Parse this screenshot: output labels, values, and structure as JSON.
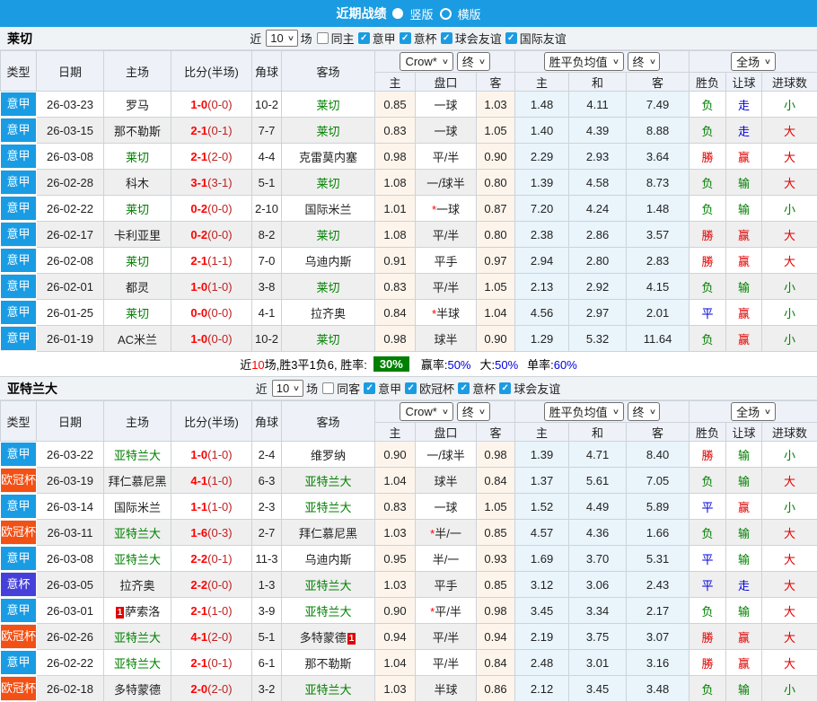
{
  "title_bar": {
    "title": "近期战绩",
    "radio_vertical": "竖版",
    "radio_horizontal": "横版"
  },
  "colors": {
    "topbar": "#1b9ce2",
    "league_serie_a": "#199ce3",
    "league_ucl": "#f25014",
    "league_coppa": "#4540da",
    "focus_team": "#008000",
    "score": "#ff0000",
    "win_red": "#e10000",
    "draw_blue": "#0000dd",
    "lose_green": "#008000"
  },
  "table_header": {
    "type": "类型",
    "date": "日期",
    "home": "主场",
    "score": "比分(半场)",
    "corner": "角球",
    "away": "客场",
    "asian_source": "Crow*",
    "asian_state": "终",
    "asian_home": "主",
    "asian_line": "盘口",
    "asian_away": "客",
    "euro_source": "胜平负均值",
    "euro_state": "终",
    "euro_home": "主",
    "euro_draw": "和",
    "euro_away": "客",
    "scope": "全场",
    "res_wl": "胜负",
    "res_handicap": "让球",
    "res_goals": "进球数"
  },
  "sections": [
    {
      "team": "莱切",
      "filter": {
        "near": "近",
        "count": "10",
        "games": "场",
        "same_label": "同主",
        "leagues": [
          "意甲",
          "意杯",
          "球会友谊",
          "国际友谊"
        ]
      },
      "rows": [
        {
          "league": "意甲",
          "date": "26-03-23",
          "home": "罗马",
          "home_focus": false,
          "home_card": "",
          "score_ft": "1-0",
          "score_ht": "(0-0)",
          "corner": "10-2",
          "away": "莱切",
          "away_focus": true,
          "away_card": "",
          "ah_home": "0.85",
          "ah_star": false,
          "ah_line": "一球",
          "ah_away": "1.03",
          "eu_home": "1.48",
          "eu_draw": "4.11",
          "eu_away": "7.49",
          "res_wl": "负",
          "res_ah": "走",
          "res_goal": "小"
        },
        {
          "league": "意甲",
          "date": "26-03-15",
          "home": "那不勒斯",
          "home_focus": false,
          "home_card": "",
          "score_ft": "2-1",
          "score_ht": "(0-1)",
          "corner": "7-7",
          "away": "莱切",
          "away_focus": true,
          "away_card": "",
          "ah_home": "0.83",
          "ah_star": false,
          "ah_line": "一球",
          "ah_away": "1.05",
          "eu_home": "1.40",
          "eu_draw": "4.39",
          "eu_away": "8.88",
          "res_wl": "负",
          "res_ah": "走",
          "res_goal": "大"
        },
        {
          "league": "意甲",
          "date": "26-03-08",
          "home": "莱切",
          "home_focus": true,
          "home_card": "",
          "score_ft": "2-1",
          "score_ht": "(2-0)",
          "corner": "4-4",
          "away": "克雷莫内塞",
          "away_focus": false,
          "away_card": "",
          "ah_home": "0.98",
          "ah_star": false,
          "ah_line": "平/半",
          "ah_away": "0.90",
          "eu_home": "2.29",
          "eu_draw": "2.93",
          "eu_away": "3.64",
          "res_wl": "勝",
          "res_ah": "赢",
          "res_goal": "大"
        },
        {
          "league": "意甲",
          "date": "26-02-28",
          "home": "科木",
          "home_focus": false,
          "home_card": "",
          "score_ft": "3-1",
          "score_ht": "(3-1)",
          "corner": "5-1",
          "away": "莱切",
          "away_focus": true,
          "away_card": "",
          "ah_home": "1.08",
          "ah_star": false,
          "ah_line": "一/球半",
          "ah_away": "0.80",
          "eu_home": "1.39",
          "eu_draw": "4.58",
          "eu_away": "8.73",
          "res_wl": "负",
          "res_ah": "输",
          "res_goal": "大"
        },
        {
          "league": "意甲",
          "date": "26-02-22",
          "home": "莱切",
          "home_focus": true,
          "home_card": "",
          "score_ft": "0-2",
          "score_ht": "(0-0)",
          "corner": "2-10",
          "away": "国际米兰",
          "away_focus": false,
          "away_card": "",
          "ah_home": "1.01",
          "ah_star": true,
          "ah_line": "一球",
          "ah_away": "0.87",
          "eu_home": "7.20",
          "eu_draw": "4.24",
          "eu_away": "1.48",
          "res_wl": "负",
          "res_ah": "输",
          "res_goal": "小"
        },
        {
          "league": "意甲",
          "date": "26-02-17",
          "home": "卡利亚里",
          "home_focus": false,
          "home_card": "",
          "score_ft": "0-2",
          "score_ht": "(0-0)",
          "corner": "8-2",
          "away": "莱切",
          "away_focus": true,
          "away_card": "",
          "ah_home": "1.08",
          "ah_star": false,
          "ah_line": "平/半",
          "ah_away": "0.80",
          "eu_home": "2.38",
          "eu_draw": "2.86",
          "eu_away": "3.57",
          "res_wl": "勝",
          "res_ah": "赢",
          "res_goal": "大"
        },
        {
          "league": "意甲",
          "date": "26-02-08",
          "home": "莱切",
          "home_focus": true,
          "home_card": "",
          "score_ft": "2-1",
          "score_ht": "(1-1)",
          "corner": "7-0",
          "away": "乌迪内斯",
          "away_focus": false,
          "away_card": "",
          "ah_home": "0.91",
          "ah_star": false,
          "ah_line": "平手",
          "ah_away": "0.97",
          "eu_home": "2.94",
          "eu_draw": "2.80",
          "eu_away": "2.83",
          "res_wl": "勝",
          "res_ah": "赢",
          "res_goal": "大"
        },
        {
          "league": "意甲",
          "date": "26-02-01",
          "home": "都灵",
          "home_focus": false,
          "home_card": "",
          "score_ft": "1-0",
          "score_ht": "(1-0)",
          "corner": "3-8",
          "away": "莱切",
          "away_focus": true,
          "away_card": "",
          "ah_home": "0.83",
          "ah_star": false,
          "ah_line": "平/半",
          "ah_away": "1.05",
          "eu_home": "2.13",
          "eu_draw": "2.92",
          "eu_away": "4.15",
          "res_wl": "负",
          "res_ah": "输",
          "res_goal": "小"
        },
        {
          "league": "意甲",
          "date": "26-01-25",
          "home": "莱切",
          "home_focus": true,
          "home_card": "",
          "score_ft": "0-0",
          "score_ht": "(0-0)",
          "corner": "4-1",
          "away": "拉齐奥",
          "away_focus": false,
          "away_card": "",
          "ah_home": "0.84",
          "ah_star": true,
          "ah_line": "半球",
          "ah_away": "1.04",
          "eu_home": "4.56",
          "eu_draw": "2.97",
          "eu_away": "2.01",
          "res_wl": "平",
          "res_ah": "赢",
          "res_goal": "小"
        },
        {
          "league": "意甲",
          "date": "26-01-19",
          "home": "AC米兰",
          "home_focus": false,
          "home_card": "",
          "score_ft": "1-0",
          "score_ht": "(0-0)",
          "corner": "10-2",
          "away": "莱切",
          "away_focus": true,
          "away_card": "",
          "ah_home": "0.98",
          "ah_star": false,
          "ah_line": "球半",
          "ah_away": "0.90",
          "eu_home": "1.29",
          "eu_draw": "5.32",
          "eu_away": "11.64",
          "res_wl": "负",
          "res_ah": "赢",
          "res_goal": "小"
        }
      ],
      "summary": {
        "prefix": "近",
        "count": "10",
        "mid": "场,胜3平1负6, 胜率:",
        "win_rate": "30%",
        "stats": [
          {
            "label": "赢率:",
            "value": "50%"
          },
          {
            "label": "大:",
            "value": "50%"
          },
          {
            "label": "单率:",
            "value": "60%"
          }
        ]
      }
    },
    {
      "team": "亚特兰大",
      "filter": {
        "near": "近",
        "count": "10",
        "games": "场",
        "same_label": "同客",
        "leagues": [
          "意甲",
          "欧冠杯",
          "意杯",
          "球会友谊"
        ]
      },
      "rows": [
        {
          "league": "意甲",
          "date": "26-03-22",
          "home": "亚特兰大",
          "home_focus": true,
          "home_card": "",
          "score_ft": "1-0",
          "score_ht": "(1-0)",
          "corner": "2-4",
          "away": "维罗纳",
          "away_focus": false,
          "away_card": "",
          "ah_home": "0.90",
          "ah_star": false,
          "ah_line": "一/球半",
          "ah_away": "0.98",
          "eu_home": "1.39",
          "eu_draw": "4.71",
          "eu_away": "8.40",
          "res_wl": "勝",
          "res_ah": "输",
          "res_goal": "小"
        },
        {
          "league": "欧冠杯",
          "date": "26-03-19",
          "home": "拜仁慕尼黑",
          "home_focus": false,
          "home_card": "",
          "score_ft": "4-1",
          "score_ht": "(1-0)",
          "corner": "6-3",
          "away": "亚特兰大",
          "away_focus": true,
          "away_card": "",
          "ah_home": "1.04",
          "ah_star": false,
          "ah_line": "球半",
          "ah_away": "0.84",
          "eu_home": "1.37",
          "eu_draw": "5.61",
          "eu_away": "7.05",
          "res_wl": "负",
          "res_ah": "输",
          "res_goal": "大"
        },
        {
          "league": "意甲",
          "date": "26-03-14",
          "home": "国际米兰",
          "home_focus": false,
          "home_card": "",
          "score_ft": "1-1",
          "score_ht": "(1-0)",
          "corner": "2-3",
          "away": "亚特兰大",
          "away_focus": true,
          "away_card": "",
          "ah_home": "0.83",
          "ah_star": false,
          "ah_line": "一球",
          "ah_away": "1.05",
          "eu_home": "1.52",
          "eu_draw": "4.49",
          "eu_away": "5.89",
          "res_wl": "平",
          "res_ah": "赢",
          "res_goal": "小"
        },
        {
          "league": "欧冠杯",
          "date": "26-03-11",
          "home": "亚特兰大",
          "home_focus": true,
          "home_card": "",
          "score_ft": "1-6",
          "score_ht": "(0-3)",
          "corner": "2-7",
          "away": "拜仁慕尼黑",
          "away_focus": false,
          "away_card": "",
          "ah_home": "1.03",
          "ah_star": true,
          "ah_line": "半/一",
          "ah_away": "0.85",
          "eu_home": "4.57",
          "eu_draw": "4.36",
          "eu_away": "1.66",
          "res_wl": "负",
          "res_ah": "输",
          "res_goal": "大"
        },
        {
          "league": "意甲",
          "date": "26-03-08",
          "home": "亚特兰大",
          "home_focus": true,
          "home_card": "",
          "score_ft": "2-2",
          "score_ht": "(0-1)",
          "corner": "11-3",
          "away": "乌迪内斯",
          "away_focus": false,
          "away_card": "",
          "ah_home": "0.95",
          "ah_star": false,
          "ah_line": "半/一",
          "ah_away": "0.93",
          "eu_home": "1.69",
          "eu_draw": "3.70",
          "eu_away": "5.31",
          "res_wl": "平",
          "res_ah": "输",
          "res_goal": "大"
        },
        {
          "league": "意杯",
          "date": "26-03-05",
          "home": "拉齐奥",
          "home_focus": false,
          "home_card": "",
          "score_ft": "2-2",
          "score_ht": "(0-0)",
          "corner": "1-3",
          "away": "亚特兰大",
          "away_focus": true,
          "away_card": "",
          "ah_home": "1.03",
          "ah_star": false,
          "ah_line": "平手",
          "ah_away": "0.85",
          "eu_home": "3.12",
          "eu_draw": "3.06",
          "eu_away": "2.43",
          "res_wl": "平",
          "res_ah": "走",
          "res_goal": "大"
        },
        {
          "league": "意甲",
          "date": "26-03-01",
          "home": "萨索洛",
          "home_focus": false,
          "home_card": "1",
          "score_ft": "2-1",
          "score_ht": "(1-0)",
          "corner": "3-9",
          "away": "亚特兰大",
          "away_focus": true,
          "away_card": "",
          "ah_home": "0.90",
          "ah_star": true,
          "ah_line": "平/半",
          "ah_away": "0.98",
          "eu_home": "3.45",
          "eu_draw": "3.34",
          "eu_away": "2.17",
          "res_wl": "负",
          "res_ah": "输",
          "res_goal": "大"
        },
        {
          "league": "欧冠杯",
          "date": "26-02-26",
          "home": "亚特兰大",
          "home_focus": true,
          "home_card": "",
          "score_ft": "4-1",
          "score_ht": "(2-0)",
          "corner": "5-1",
          "away": "多特蒙德",
          "away_focus": false,
          "away_card": "1",
          "ah_home": "0.94",
          "ah_star": false,
          "ah_line": "平/半",
          "ah_away": "0.94",
          "eu_home": "2.19",
          "eu_draw": "3.75",
          "eu_away": "3.07",
          "res_wl": "勝",
          "res_ah": "赢",
          "res_goal": "大"
        },
        {
          "league": "意甲",
          "date": "26-02-22",
          "home": "亚特兰大",
          "home_focus": true,
          "home_card": "",
          "score_ft": "2-1",
          "score_ht": "(0-1)",
          "corner": "6-1",
          "away": "那不勒斯",
          "away_focus": false,
          "away_card": "",
          "ah_home": "1.04",
          "ah_star": false,
          "ah_line": "平/半",
          "ah_away": "0.84",
          "eu_home": "2.48",
          "eu_draw": "3.01",
          "eu_away": "3.16",
          "res_wl": "勝",
          "res_ah": "赢",
          "res_goal": "大"
        },
        {
          "league": "欧冠杯",
          "date": "26-02-18",
          "home": "多特蒙德",
          "home_focus": false,
          "home_card": "",
          "score_ft": "2-0",
          "score_ht": "(2-0)",
          "corner": "3-2",
          "away": "亚特兰大",
          "away_focus": true,
          "away_card": "",
          "ah_home": "1.03",
          "ah_star": false,
          "ah_line": "半球",
          "ah_away": "0.86",
          "eu_home": "2.12",
          "eu_draw": "3.45",
          "eu_away": "3.48",
          "res_wl": "负",
          "res_ah": "输",
          "res_goal": "小"
        }
      ]
    }
  ]
}
